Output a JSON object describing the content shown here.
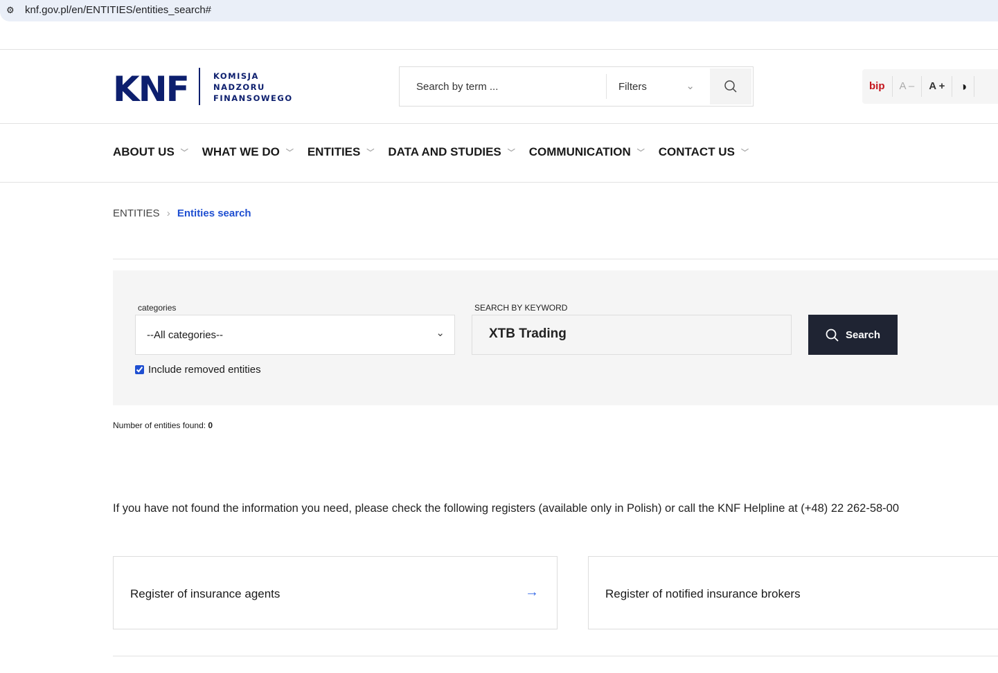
{
  "browser": {
    "url": "knf.gov.pl/en/ENTITIES/entities_search#"
  },
  "logo": {
    "abbr": "KNF",
    "line1": "KOMISJA",
    "line2": "NADZORU",
    "line3": "FINANSOWEGO"
  },
  "header_search": {
    "placeholder": "Search by term ...",
    "filters": "Filters"
  },
  "accessibility": {
    "bip": "bip",
    "decrease": "A –",
    "increase": "A +"
  },
  "nav": [
    "ABOUT US",
    "WHAT WE DO",
    "ENTITIES",
    "DATA AND STUDIES",
    "COMMUNICATION",
    "CONTACT US"
  ],
  "breadcrumb": {
    "parent": "ENTITIES",
    "current": "Entities search"
  },
  "form": {
    "categories_label": "categories",
    "categories_value": "--All categories--",
    "keyword_label": "SEARCH BY KEYWORD",
    "keyword_value": "XTB Trading",
    "search_button": "Search",
    "include_removed": "Include removed entities",
    "include_removed_checked": true
  },
  "results": {
    "label": "Number of entities found:",
    "count": "0"
  },
  "info": "If you have not found the information you need, please check the following registers (available only in Polish) or call the KNF Helpline at (+48) 22 262-58-00",
  "registers": [
    "Register of insurance agents",
    "Register of notified insurance brokers"
  ]
}
